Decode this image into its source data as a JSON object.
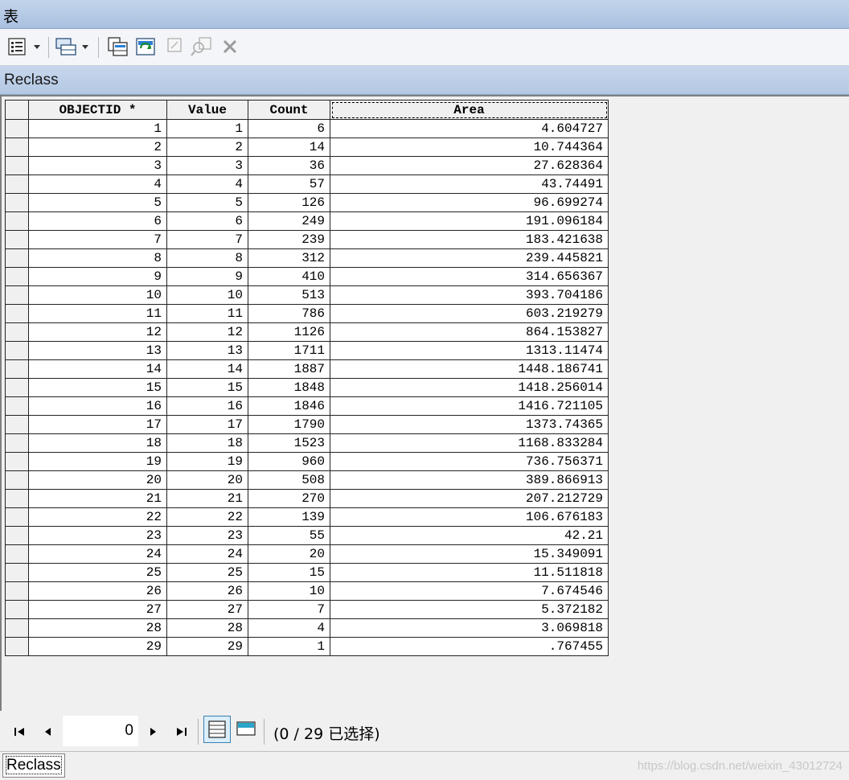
{
  "window": {
    "title": "表"
  },
  "toolbar": {
    "icons": [
      "table-options-icon",
      "related-tables-icon",
      "select-by-attributes-icon",
      "switch-selection-icon",
      "clear-selection-icon",
      "zoom-to-selected-icon",
      "delete-selected-icon"
    ]
  },
  "table": {
    "name": "Reclass",
    "columns": [
      "OBJECTID *",
      "Value",
      "Count",
      "Area"
    ],
    "rows": [
      [
        "1",
        "1",
        "6",
        "4.604727"
      ],
      [
        "2",
        "2",
        "14",
        "10.744364"
      ],
      [
        "3",
        "3",
        "36",
        "27.628364"
      ],
      [
        "4",
        "4",
        "57",
        "43.74491"
      ],
      [
        "5",
        "5",
        "126",
        "96.699274"
      ],
      [
        "6",
        "6",
        "249",
        "191.096184"
      ],
      [
        "7",
        "7",
        "239",
        "183.421638"
      ],
      [
        "8",
        "8",
        "312",
        "239.445821"
      ],
      [
        "9",
        "9",
        "410",
        "314.656367"
      ],
      [
        "10",
        "10",
        "513",
        "393.704186"
      ],
      [
        "11",
        "11",
        "786",
        "603.219279"
      ],
      [
        "12",
        "12",
        "1126",
        "864.153827"
      ],
      [
        "13",
        "13",
        "1711",
        "1313.11474"
      ],
      [
        "14",
        "14",
        "1887",
        "1448.186741"
      ],
      [
        "15",
        "15",
        "1848",
        "1418.256014"
      ],
      [
        "16",
        "16",
        "1846",
        "1416.721105"
      ],
      [
        "17",
        "17",
        "1790",
        "1373.74365"
      ],
      [
        "18",
        "18",
        "1523",
        "1168.833284"
      ],
      [
        "19",
        "19",
        "960",
        "736.756371"
      ],
      [
        "20",
        "20",
        "508",
        "389.866913"
      ],
      [
        "21",
        "21",
        "270",
        "207.212729"
      ],
      [
        "22",
        "22",
        "139",
        "106.676183"
      ],
      [
        "23",
        "23",
        "55",
        "42.21"
      ],
      [
        "24",
        "24",
        "20",
        "15.349091"
      ],
      [
        "25",
        "25",
        "15",
        "11.511818"
      ],
      [
        "26",
        "26",
        "10",
        "7.674546"
      ],
      [
        "27",
        "27",
        "7",
        "5.372182"
      ],
      [
        "28",
        "28",
        "4",
        "3.069818"
      ],
      [
        "29",
        "29",
        "1",
        ".767455"
      ]
    ]
  },
  "status": {
    "record_number": "0",
    "selection_text": "(0 / 29 已选择)"
  },
  "bottom_tab": {
    "label": "Reclass"
  },
  "watermark": "https://blog.csdn.net/weixin_43012724"
}
